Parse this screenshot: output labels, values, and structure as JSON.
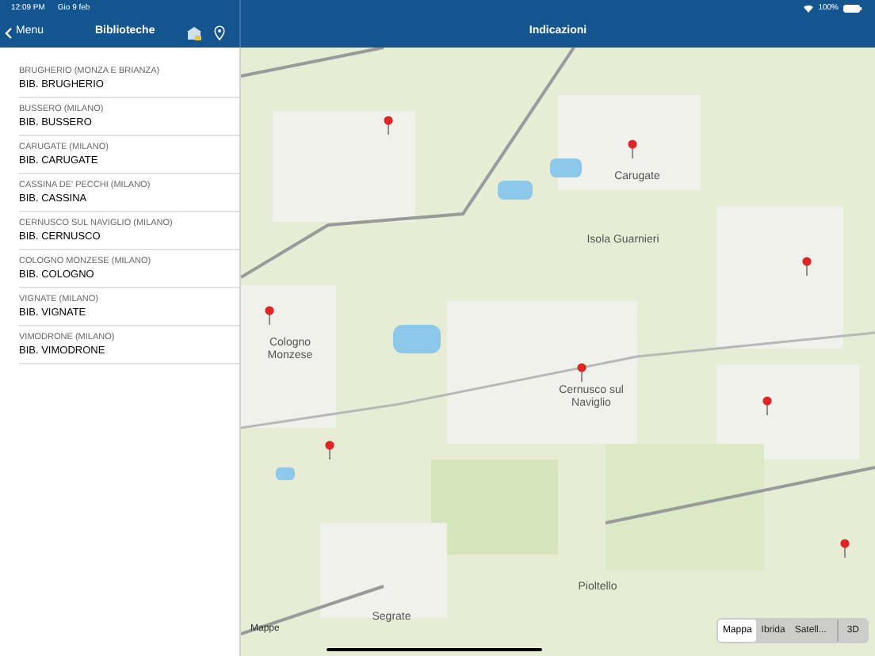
{
  "status_bar": {
    "time": "12:09 PM",
    "date": "Gio 9 feb",
    "battery": "100%"
  },
  "sidebar": {
    "back": "Menu",
    "title": "Biblioteche",
    "items": [
      {
        "place": "BRUGHERIO (MONZA E BRIANZA)",
        "name": "BIB. BRUGHERIO"
      },
      {
        "place": "BUSSERO (MILANO)",
        "name": "BIB. BUSSERO"
      },
      {
        "place": "CARUGATE (MILANO)",
        "name": "BIB. CARUGATE"
      },
      {
        "place": "CASSINA DE' PECCHI (MILANO)",
        "name": "BIB. CASSINA"
      },
      {
        "place": "CERNUSCO SUL NAVIGLIO (MILANO)",
        "name": "BIB. CERNUSCO"
      },
      {
        "place": "COLOGNO MONZESE (MILANO)",
        "name": "BIB. COLOGNO"
      },
      {
        "place": "VIGNATE (MILANO)",
        "name": "BIB. VIGNATE"
      },
      {
        "place": "VIMODRONE (MILANO)",
        "name": "BIB. VIMODRONE"
      }
    ]
  },
  "detail": {
    "title": "Indicazioni"
  },
  "map": {
    "places": [
      "Carugate",
      "Isola Guarnieri",
      "Cologno Monzese",
      "Cernusco sul Naviglio",
      "Segrate",
      "Pioltello"
    ],
    "attribution": "Mappe",
    "map_types": [
      {
        "label": "Mappa",
        "selected": true
      },
      {
        "label": "Ibrida",
        "selected": false
      },
      {
        "label": "Satell...",
        "selected": false
      }
    ],
    "view_3d": "3D"
  }
}
